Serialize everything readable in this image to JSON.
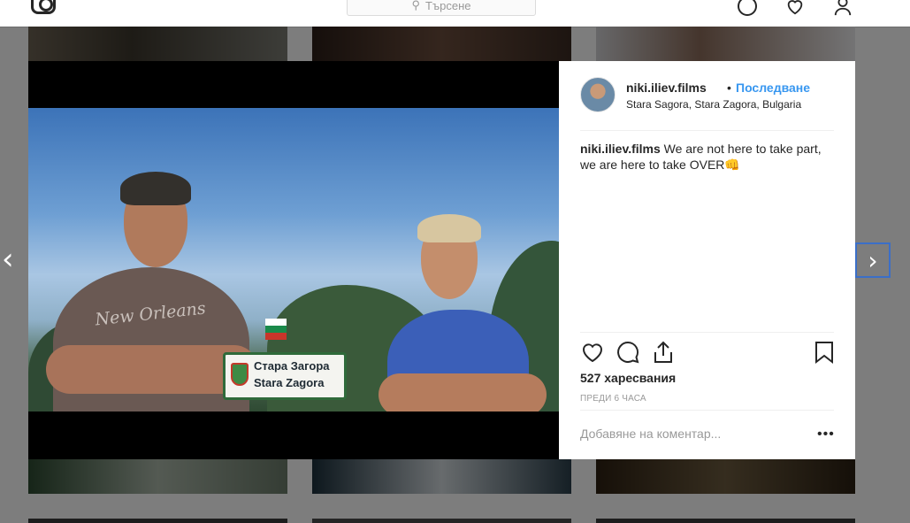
{
  "topbar": {
    "search_placeholder": "Търсене"
  },
  "post": {
    "username": "niki.iliev.films",
    "follow_label": "Последване",
    "separator": "•",
    "location": "Stara Sagora, Stara Zagora, Bulgaria",
    "caption_user": "niki.iliev.films",
    "caption_text": "We are not here to take part, we are here to take OVER👊",
    "likes": "527 харесвания",
    "timestamp": "ПРЕДИ 6 ЧАСА",
    "comment_placeholder": "Добавяне на коментар...",
    "more_label": "•••"
  },
  "photo": {
    "tshirt_text": "New Orleans",
    "sign_line1": "Стара Загора",
    "sign_line2": "Stara Zagora"
  },
  "navigation": {
    "prev": "‹",
    "next": "›"
  },
  "colors": {
    "link": "#3897f0",
    "next_focus": "#3b6fc8"
  }
}
